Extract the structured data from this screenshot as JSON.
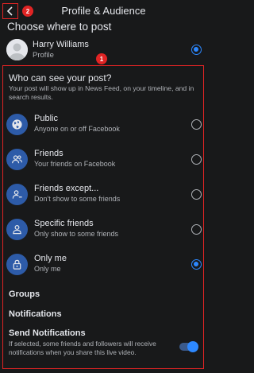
{
  "header": {
    "title": "Profile & Audience",
    "badge_back": "2",
    "badge_box": "1"
  },
  "choose_title": "Choose where to post",
  "profile": {
    "name": "Harry Williams",
    "sub": "Profile",
    "selected": true
  },
  "audience": {
    "title": "Who can see your post?",
    "description": "Your post will show up in News Feed, on your timeline, and in search results.",
    "options": [
      {
        "label": "Public",
        "sub": "Anyone on or off Facebook",
        "icon": "globe-icon",
        "selected": false
      },
      {
        "label": "Friends",
        "sub": "Your friends on Facebook",
        "icon": "friends-icon",
        "selected": false
      },
      {
        "label": "Friends except...",
        "sub": "Don't show to some friends",
        "icon": "friends-except-icon",
        "selected": false
      },
      {
        "label": "Specific friends",
        "sub": "Only show to some friends",
        "icon": "specific-friends-icon",
        "selected": false
      },
      {
        "label": "Only me",
        "sub": "Only me",
        "icon": "lock-icon",
        "selected": true
      }
    ]
  },
  "groups_label": "Groups",
  "notifications_label": "Notifications",
  "send_notifications": {
    "label": "Send Notifications",
    "description": "If selected, some friends and followers will receive notifications when you share this live video.",
    "enabled": true
  },
  "colors": {
    "background": "#18191a",
    "accent": "#2d88ff",
    "icon_bg": "#2d5ba8",
    "annotation": "#e02424"
  }
}
